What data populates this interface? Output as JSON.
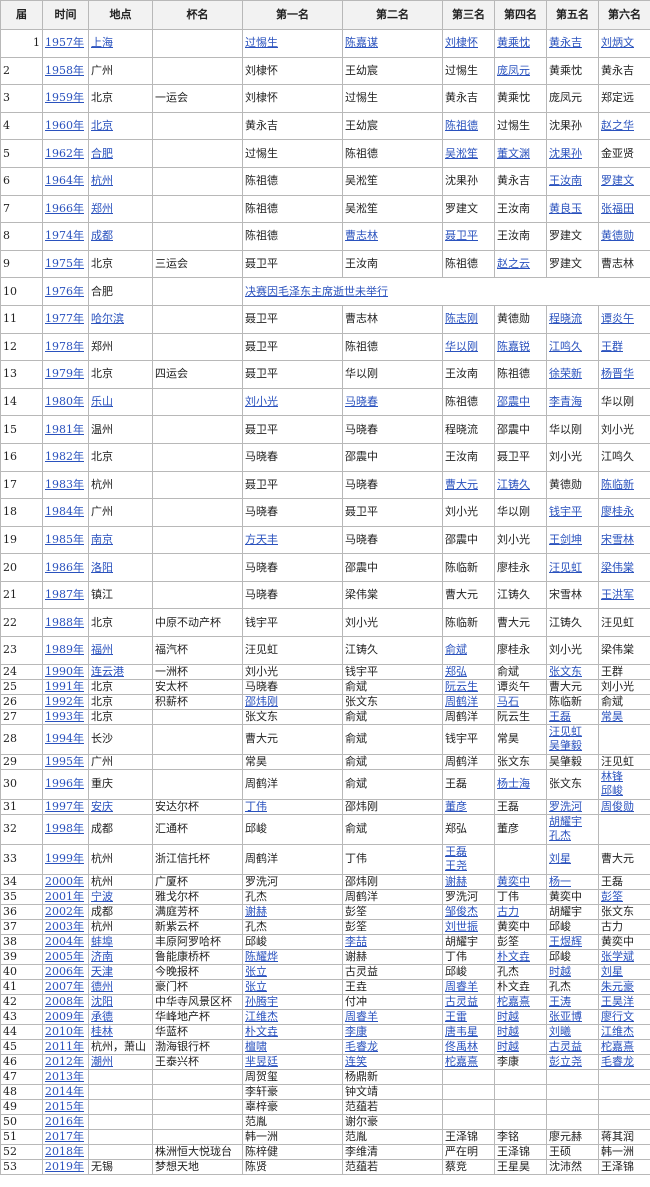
{
  "columns": [
    "届",
    "时间",
    "地点",
    "杯名",
    "第一名",
    "第二名",
    "第三名",
    "第四名",
    "第五名",
    "第六名"
  ],
  "rows": [
    {
      "n": "1",
      "y": "1957年",
      "p": "上海",
      "cup": "",
      "r": [
        "过惕生",
        "陈嘉谋",
        "刘棣怀",
        "黄乘忱",
        "黄永吉",
        "刘炳文"
      ]
    },
    {
      "n": "2",
      "y": "1958年",
      "p": "广州",
      "cup": "",
      "r": [
        "刘棣怀",
        "王幼宸",
        "过惕生",
        "庞凤元",
        "黄乘忱",
        "黄永吉"
      ]
    },
    {
      "n": "3",
      "y": "1959年",
      "p": "北京",
      "cup": "一运会",
      "r": [
        "刘棣怀",
        "过惕生",
        "黄永吉",
        "黄乘忱",
        "庞凤元",
        "郑定远"
      ]
    },
    {
      "n": "4",
      "y": "1960年",
      "p": "北京",
      "cup": "",
      "r": [
        "黄永吉",
        "王幼宸",
        "陈祖德",
        "过惕生",
        "沈果孙",
        "赵之华"
      ]
    },
    {
      "n": "5",
      "y": "1962年",
      "p": "合肥",
      "cup": "",
      "r": [
        "过惕生",
        "陈祖德",
        "吴淞笙",
        "董文渊",
        "沈果孙",
        "金亚贤"
      ]
    },
    {
      "n": "6",
      "y": "1964年",
      "p": "杭州",
      "cup": "",
      "r": [
        "陈祖德",
        "吴淞笙",
        "沈果孙",
        "黄永吉",
        "王汝南",
        "罗建文"
      ]
    },
    {
      "n": "7",
      "y": "1966年",
      "p": "郑州",
      "cup": "",
      "r": [
        "陈祖德",
        "吴淞笙",
        "罗建文",
        "王汝南",
        "黄良玉",
        "张福田"
      ]
    },
    {
      "n": "8",
      "y": "1974年",
      "p": "成都",
      "cup": "",
      "r": [
        "陈祖德",
        "曹志林",
        "聂卫平",
        "王汝南",
        "罗建文",
        "黄德勋"
      ]
    },
    {
      "n": "9",
      "y": "1975年",
      "p": "北京",
      "cup": "三运会",
      "r": [
        "聂卫平",
        "王汝南",
        "陈祖德",
        "赵之云",
        "罗建文",
        "曹志林"
      ]
    },
    {
      "n": "10",
      "y": "1976年",
      "p": "合肥",
      "cup": "",
      "note": "决赛因毛泽东主席逝世未举行"
    },
    {
      "n": "11",
      "y": "1977年",
      "p": "哈尔滨",
      "cup": "",
      "r": [
        "聂卫平",
        "曹志林",
        "陈志刚",
        "黄德勋",
        "程晓流",
        "谭炎午"
      ]
    },
    {
      "n": "12",
      "y": "1978年",
      "p": "郑州",
      "cup": "",
      "r": [
        "聂卫平",
        "陈祖德",
        "华以刚",
        "陈嘉锐",
        "江鸣久",
        "王群"
      ]
    },
    {
      "n": "13",
      "y": "1979年",
      "p": "北京",
      "cup": "四运会",
      "r": [
        "聂卫平",
        "华以刚",
        "王汝南",
        "陈祖德",
        "徐荣新",
        "杨晋华"
      ]
    },
    {
      "n": "14",
      "y": "1980年",
      "p": "乐山",
      "cup": "",
      "r": [
        "刘小光",
        "马晓春",
        "陈祖德",
        "邵震中",
        "李青海",
        "华以刚"
      ]
    },
    {
      "n": "15",
      "y": "1981年",
      "p": "温州",
      "cup": "",
      "r": [
        "聂卫平",
        "马晓春",
        "程晓流",
        "邵震中",
        "华以刚",
        "刘小光"
      ]
    },
    {
      "n": "16",
      "y": "1982年",
      "p": "北京",
      "cup": "",
      "r": [
        "马晓春",
        "邵震中",
        "王汝南",
        "聂卫平",
        "刘小光",
        "江鸣久"
      ]
    },
    {
      "n": "17",
      "y": "1983年",
      "p": "杭州",
      "cup": "",
      "r": [
        "聂卫平",
        "马晓春",
        "曹大元",
        "江铸久",
        "黄德勋",
        "陈临新"
      ]
    },
    {
      "n": "18",
      "y": "1984年",
      "p": "广州",
      "cup": "",
      "r": [
        "马晓春",
        "聂卫平",
        "刘小光",
        "华以刚",
        "钱宇平",
        "廖桂永"
      ]
    },
    {
      "n": "19",
      "y": "1985年",
      "p": "南京",
      "cup": "",
      "r": [
        "方天丰",
        "马晓春",
        "邵震中",
        "刘小光",
        "王剑坤",
        "宋雪林"
      ]
    },
    {
      "n": "20",
      "y": "1986年",
      "p": "洛阳",
      "cup": "",
      "r": [
        "马晓春",
        "邵震中",
        "陈临新",
        "廖桂永",
        "汪见虹",
        "梁伟棠"
      ]
    },
    {
      "n": "21",
      "y": "1987年",
      "p": "镇江",
      "cup": "",
      "r": [
        "马晓春",
        "梁伟棠",
        "曹大元",
        "江铸久",
        "宋雪林",
        "王洪军"
      ]
    },
    {
      "n": "22",
      "y": "1988年",
      "p": "北京",
      "cup": "中原不动产杯",
      "r": [
        "钱宇平",
        "刘小光",
        "陈临新",
        "曹大元",
        "江铸久",
        "汪见虹"
      ]
    },
    {
      "n": "23",
      "y": "1989年",
      "p": "福州",
      "cup": "福汽杯",
      "r": [
        "汪见虹",
        "江铸久",
        "俞斌",
        "廖桂永",
        "刘小光",
        "梁伟棠"
      ]
    },
    {
      "n": "24",
      "y": "1990年",
      "p": "连云港",
      "cup": "一洲杯",
      "r": [
        "刘小光",
        "钱宇平",
        "郑弘",
        "俞斌",
        "张文东",
        "王群"
      ]
    },
    {
      "n": "25",
      "y": "1991年",
      "p": "北京",
      "cup": "安太杯",
      "r": [
        "马晓春",
        "俞斌",
        "阮云生",
        "谭炎午",
        "曹大元",
        "刘小光"
      ]
    },
    {
      "n": "26",
      "y": "1992年",
      "p": "北京",
      "cup": "积薪杯",
      "r": [
        "邵炜刚",
        "张文东",
        "周鹤洋",
        "马石",
        "陈临新",
        "俞斌"
      ]
    },
    {
      "n": "27",
      "y": "1993年",
      "p": "北京",
      "cup": "",
      "r": [
        "张文东",
        "俞斌",
        "周鹤洋",
        "阮云生",
        "王磊",
        "常昊"
      ]
    },
    {
      "n": "28",
      "y": "1994年",
      "p": "长沙",
      "cup": "",
      "r": [
        "曹大元",
        "俞斌",
        "钱宇平",
        "常昊",
        "汪见虹|吴肇毅",
        ""
      ]
    },
    {
      "n": "29",
      "y": "1995年",
      "p": "广州",
      "cup": "",
      "r": [
        "常昊",
        "俞斌",
        "周鹤洋",
        "张文东",
        "吴肇毅",
        "汪见虹"
      ]
    },
    {
      "n": "30",
      "y": "1996年",
      "p": "重庆",
      "cup": "",
      "r": [
        "周鹤洋",
        "俞斌",
        "王磊",
        "杨士海",
        "张文东",
        "林锋|邱峻"
      ]
    },
    {
      "n": "31",
      "y": "1997年",
      "p": "安庆",
      "cup": "安达尔杯",
      "r": [
        "丁伟",
        "邵炜刚",
        "董彦",
        "王磊",
        "罗洗河",
        "周俊勋"
      ]
    },
    {
      "n": "32",
      "y": "1998年",
      "p": "成都",
      "cup": "汇通杯",
      "r": [
        "邱峻",
        "俞斌",
        "郑弘",
        "董彦",
        "胡耀宇|孔杰",
        ""
      ]
    },
    {
      "n": "33",
      "y": "1999年",
      "p": "杭州",
      "cup": "浙江信托杯",
      "r": [
        "周鹤洋",
        "丁伟",
        "王磊|王尧",
        "",
        "刘星",
        "曹大元"
      ]
    },
    {
      "n": "34",
      "y": "2000年",
      "p": "杭州",
      "cup": "广厦杯",
      "r": [
        "罗洗河",
        "邵炜刚",
        "谢赫",
        "黄奕中",
        "杨一",
        "王磊"
      ]
    },
    {
      "n": "35",
      "y": "2001年",
      "p": "宁波",
      "cup": "雅戈尔杯",
      "r": [
        "孔杰",
        "周鹤洋",
        "罗洗河",
        "丁伟",
        "黄奕中",
        "彭筌"
      ]
    },
    {
      "n": "36",
      "y": "2002年",
      "p": "成都",
      "cup": "满庭芳杯",
      "r": [
        "谢赫",
        "彭筌",
        "邹俊杰",
        "古力",
        "胡耀宇",
        "张文东"
      ]
    },
    {
      "n": "37",
      "y": "2003年",
      "p": "杭州",
      "cup": "新紫云杯",
      "r": [
        "孔杰",
        "彭筌",
        "刘世振",
        "黄奕中",
        "邱峻",
        "古力"
      ]
    },
    {
      "n": "38",
      "y": "2004年",
      "p": "蚌埠",
      "cup": "丰原阿罗哈杯",
      "r": [
        "邱峻",
        "李喆",
        "胡耀宇",
        "彭筌",
        "王煜辉",
        "黄奕中"
      ]
    },
    {
      "n": "39",
      "y": "2005年",
      "p": "济南",
      "cup": "鲁能康桥杯",
      "r": [
        "陈耀烨",
        "谢赫",
        "丁伟",
        "朴文垚",
        "邱峻",
        "张学斌"
      ]
    },
    {
      "n": "40",
      "y": "2006年",
      "p": "天津",
      "cup": "今晚报杯",
      "r": [
        "张立",
        "古灵益",
        "邱峻",
        "孔杰",
        "时越",
        "刘星"
      ]
    },
    {
      "n": "41",
      "y": "2007年",
      "p": "德州",
      "cup": "豪门杯",
      "r": [
        "张立",
        "王垚",
        "周睿羊",
        "朴文垚",
        "孔杰",
        "朱元豪"
      ]
    },
    {
      "n": "42",
      "y": "2008年",
      "p": "沈阳",
      "cup": "中华寺风景区杯",
      "r": [
        "孙腾宇",
        "付冲",
        "古灵益",
        "柁嘉熹",
        "王涛",
        "王昊洋"
      ]
    },
    {
      "n": "43",
      "y": "2009年",
      "p": "承德",
      "cup": "华峰地产杯",
      "r": [
        "江维杰",
        "周睿羊",
        "王雷",
        "时越",
        "张亚博",
        "廖行文"
      ]
    },
    {
      "n": "44",
      "y": "2010年",
      "p": "桂林",
      "cup": "华蓝杯",
      "r": [
        "朴文垚",
        "李康",
        "唐韦星",
        "时越",
        "刘曦",
        "江维杰"
      ]
    },
    {
      "n": "45",
      "y": "2011年",
      "p": "杭州，萧山",
      "cup": "渤海银行杯",
      "r": [
        "檀啸",
        "毛睿龙",
        "佟禹林",
        "时越",
        "古灵益",
        "柁嘉熹"
      ]
    },
    {
      "n": "46",
      "y": "2012年",
      "p": "潮州",
      "cup": "王泰兴杯",
      "r": [
        "芈昱廷",
        "连笑",
        "柁嘉熹",
        "李康",
        "彭立尧",
        "毛睿龙"
      ]
    },
    {
      "n": "47",
      "y": "2013年",
      "p": "",
      "cup": "",
      "r": [
        "周贺玺",
        "杨鼎新",
        "",
        "",
        "",
        ""
      ]
    },
    {
      "n": "48",
      "y": "2014年",
      "p": "",
      "cup": "",
      "r": [
        "李轩豪",
        "钟文靖",
        "",
        "",
        "",
        ""
      ]
    },
    {
      "n": "49",
      "y": "2015年",
      "p": "",
      "cup": "",
      "r": [
        "辜梓豪",
        "范蕴若",
        "",
        "",
        "",
        ""
      ]
    },
    {
      "n": "50",
      "y": "2016年",
      "p": "",
      "cup": "",
      "r": [
        "范胤",
        "谢尔豪",
        "",
        "",
        "",
        ""
      ]
    },
    {
      "n": "51",
      "y": "2017年",
      "p": "",
      "cup": "",
      "r": [
        "韩一洲",
        "范胤",
        "王泽锦",
        "李铭",
        "廖元赫",
        "蒋其润"
      ]
    },
    {
      "n": "52",
      "y": "2018年",
      "p": "",
      "cup": "株洲恒大悦珑台",
      "r": [
        "陈梓健",
        "李维清",
        "严在明",
        "王泽锦",
        "王硕",
        "韩一洲"
      ]
    },
    {
      "n": "53",
      "y": "2019年",
      "p": "无锡",
      "cup": "梦想天地",
      "r": [
        "陈贤",
        "范蕴若",
        "蔡竞",
        "王星昊",
        "沈沛然",
        "王泽锦"
      ]
    }
  ]
}
